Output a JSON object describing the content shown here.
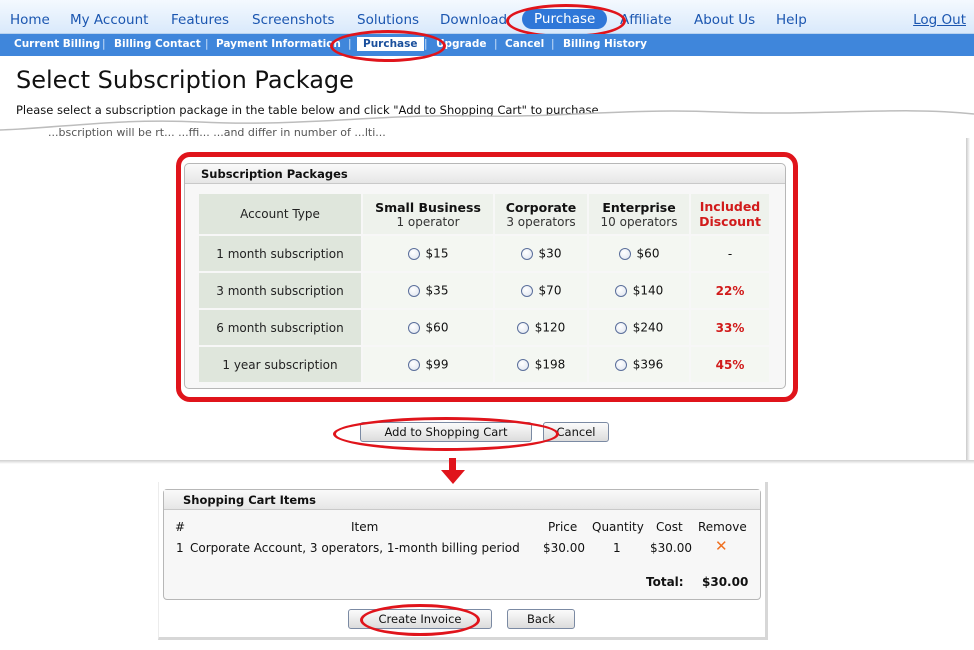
{
  "topnav": {
    "items": [
      "Home",
      "My Account",
      "Features",
      "Screenshots",
      "Solutions",
      "Download",
      "Purchase",
      "Affiliate",
      "About Us",
      "Help"
    ],
    "logout": "Log Out"
  },
  "subnav": {
    "items": [
      "Current Billing",
      "Billing Contact",
      "Payment Information",
      "Purchase",
      "Upgrade",
      "Cancel",
      "Billing History"
    ]
  },
  "page": {
    "title": "Select Subscription Package",
    "intro": "Please select a subscription package in the table below and click \"Add to Shopping Cart\" to purchase.",
    "partial_text": "...bscription will be rt... ...ffi... ...and differ in number of ...lti..."
  },
  "packages": {
    "panel_title": "Subscription Packages",
    "account_type_header": "Account Type",
    "columns": [
      {
        "name": "Small Business",
        "operators": "1 operator"
      },
      {
        "name": "Corporate",
        "operators": "3 operators"
      },
      {
        "name": "Enterprise",
        "operators": "10 operators"
      }
    ],
    "discount_header_1": "Included",
    "discount_header_2": "Discount",
    "rows": [
      {
        "label": "1 month subscription",
        "prices": [
          "$15",
          "$30",
          "$60"
        ],
        "discount": "-"
      },
      {
        "label": "3 month subscription",
        "prices": [
          "$35",
          "$70",
          "$140"
        ],
        "discount": "22%"
      },
      {
        "label": "6 month subscription",
        "prices": [
          "$60",
          "$120",
          "$240"
        ],
        "discount": "33%"
      },
      {
        "label": "1 year subscription",
        "prices": [
          "$99",
          "$198",
          "$396"
        ],
        "discount": "45%"
      }
    ]
  },
  "buttons": {
    "add_to_cart": "Add to Shopping Cart",
    "cancel": "Cancel",
    "create_invoice": "Create Invoice",
    "back": "Back"
  },
  "cart": {
    "title": "Shopping Cart Items",
    "headers": {
      "num": "#",
      "item": "Item",
      "price": "Price",
      "quantity": "Quantity",
      "cost": "Cost",
      "remove": "Remove"
    },
    "items": [
      {
        "num": "1",
        "item": "Corporate Account, 3 operators, 1-month billing period",
        "price": "$30.00",
        "quantity": "1",
        "cost": "$30.00",
        "remove_icon": "x-icon"
      }
    ],
    "total_label": "Total:",
    "total_value": "$30.00"
  },
  "colors": {
    "highlight": "#e0141b",
    "nav_active": "#2f77d8",
    "subnav_bg": "#3f86db",
    "discount": "#d11b1b"
  }
}
